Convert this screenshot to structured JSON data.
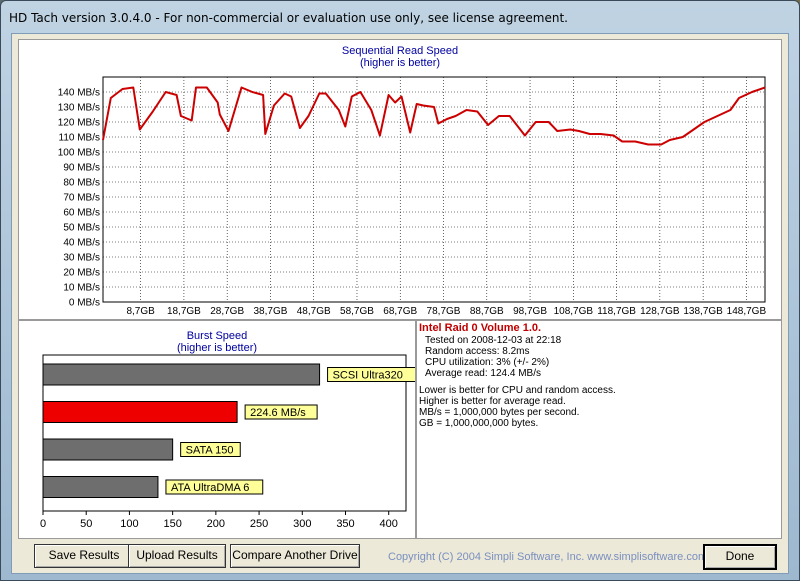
{
  "window": {
    "title": "HD Tach version 3.0.4.0  - For non-commercial or evaluation use only, see license agreement."
  },
  "sequential": {
    "title": "Sequential Read Speed",
    "subtitle": "(higher is better)"
  },
  "burst": {
    "title": "Burst Speed",
    "subtitle": "(higher is better)"
  },
  "info": {
    "heading": "Intel Raid 0 Volume 1.0.",
    "lines": [
      "Tested on 2008-12-03 at 22:18",
      "Random access: 8.2ms",
      "CPU utilization: 3% (+/- 2%)",
      "Average read: 124.4 MB/s"
    ],
    "notes": [
      "Lower is better for CPU and random access.",
      "Higher is better for average read.",
      "MB/s = 1,000,000 bytes per second.",
      "GB = 1,000,000,000 bytes."
    ]
  },
  "buttons": {
    "save": "Save Results",
    "upload": "Upload Results",
    "compare": "Compare Another Drive",
    "done": "Done"
  },
  "copyright": "Copyright (C) 2004 Simpli Software, Inc. www.simplisoftware.com",
  "chart_data": [
    {
      "type": "line",
      "title": "Sequential Read Speed",
      "subtitle": "(higher is better)",
      "y_tick_labels": [
        "0 MB/s",
        "10 MB/s",
        "20 MB/s",
        "30 MB/s",
        "40 MB/s",
        "50 MB/s",
        "60 MB/s",
        "70 MB/s",
        "80 MB/s",
        "90 MB/s",
        "100 MB/s",
        "110 MB/s",
        "120 MB/s",
        "130 MB/s",
        "140 MB/s"
      ],
      "x_tick_labels": [
        "8,7GB",
        "18,7GB",
        "28,7GB",
        "38,7GB",
        "48,7GB",
        "58,7GB",
        "68,7GB",
        "78,7GB",
        "88,7GB",
        "98,7GB",
        "108,7GB",
        "118,7GB",
        "128,7GB",
        "138,7GB",
        "148,7GB"
      ],
      "ylim": [
        0,
        150
      ],
      "xlim": [
        0,
        153
      ],
      "grid": true,
      "color": "#cc0000",
      "series": [
        {
          "x": [
            0,
            1.8,
            4.5,
            7,
            8.5,
            11.5,
            14.5,
            17,
            18,
            20.5,
            21.5,
            24,
            26.5,
            27,
            29,
            32,
            34.5,
            37,
            37.5,
            39.5,
            42,
            43.5,
            45.5,
            47.5,
            50,
            51.5,
            54.5,
            56,
            57.5,
            59.5,
            62,
            64,
            66,
            67.5,
            69,
            71,
            72.5,
            74,
            76.5,
            77.5,
            79.5,
            81.5,
            84,
            86.5,
            89,
            91.5,
            94,
            97.5,
            100,
            103,
            105,
            108,
            110,
            112.5,
            115,
            118,
            120,
            123,
            126,
            129,
            131,
            134,
            137,
            139,
            142,
            145,
            147,
            150,
            153
          ],
          "y": [
            108,
            136,
            142,
            143,
            115,
            127,
            140,
            138,
            124,
            121,
            143,
            143,
            133,
            125,
            114,
            143,
            140,
            138,
            112,
            131,
            139,
            137,
            116,
            124,
            139,
            139,
            128,
            117,
            137,
            140,
            128,
            111,
            138,
            133,
            137,
            113,
            132,
            131,
            130,
            119,
            122,
            124,
            128,
            127,
            118,
            124,
            124,
            111,
            120,
            120,
            114,
            115,
            114,
            112,
            112,
            111,
            107,
            107,
            105,
            105,
            108,
            110,
            116,
            120,
            124,
            128,
            136,
            140,
            143
          ]
        }
      ]
    },
    {
      "type": "bar",
      "orientation": "horizontal",
      "title": "Burst Speed",
      "subtitle": "(higher is better)",
      "x_tick_labels": [
        "0",
        "50",
        "100",
        "150",
        "200",
        "250",
        "300",
        "350",
        "400"
      ],
      "xlim": [
        0,
        420
      ],
      "categories": [
        "SCSI Ultra320",
        "224.6 MB/s",
        "SATA 150",
        "ATA UltraDMA 6"
      ],
      "values": [
        320,
        224.6,
        150,
        133
      ],
      "colors": [
        "#6e6e6e",
        "#ee0000",
        "#6e6e6e",
        "#6e6e6e"
      ],
      "label_bg": "#ffff99"
    }
  ]
}
